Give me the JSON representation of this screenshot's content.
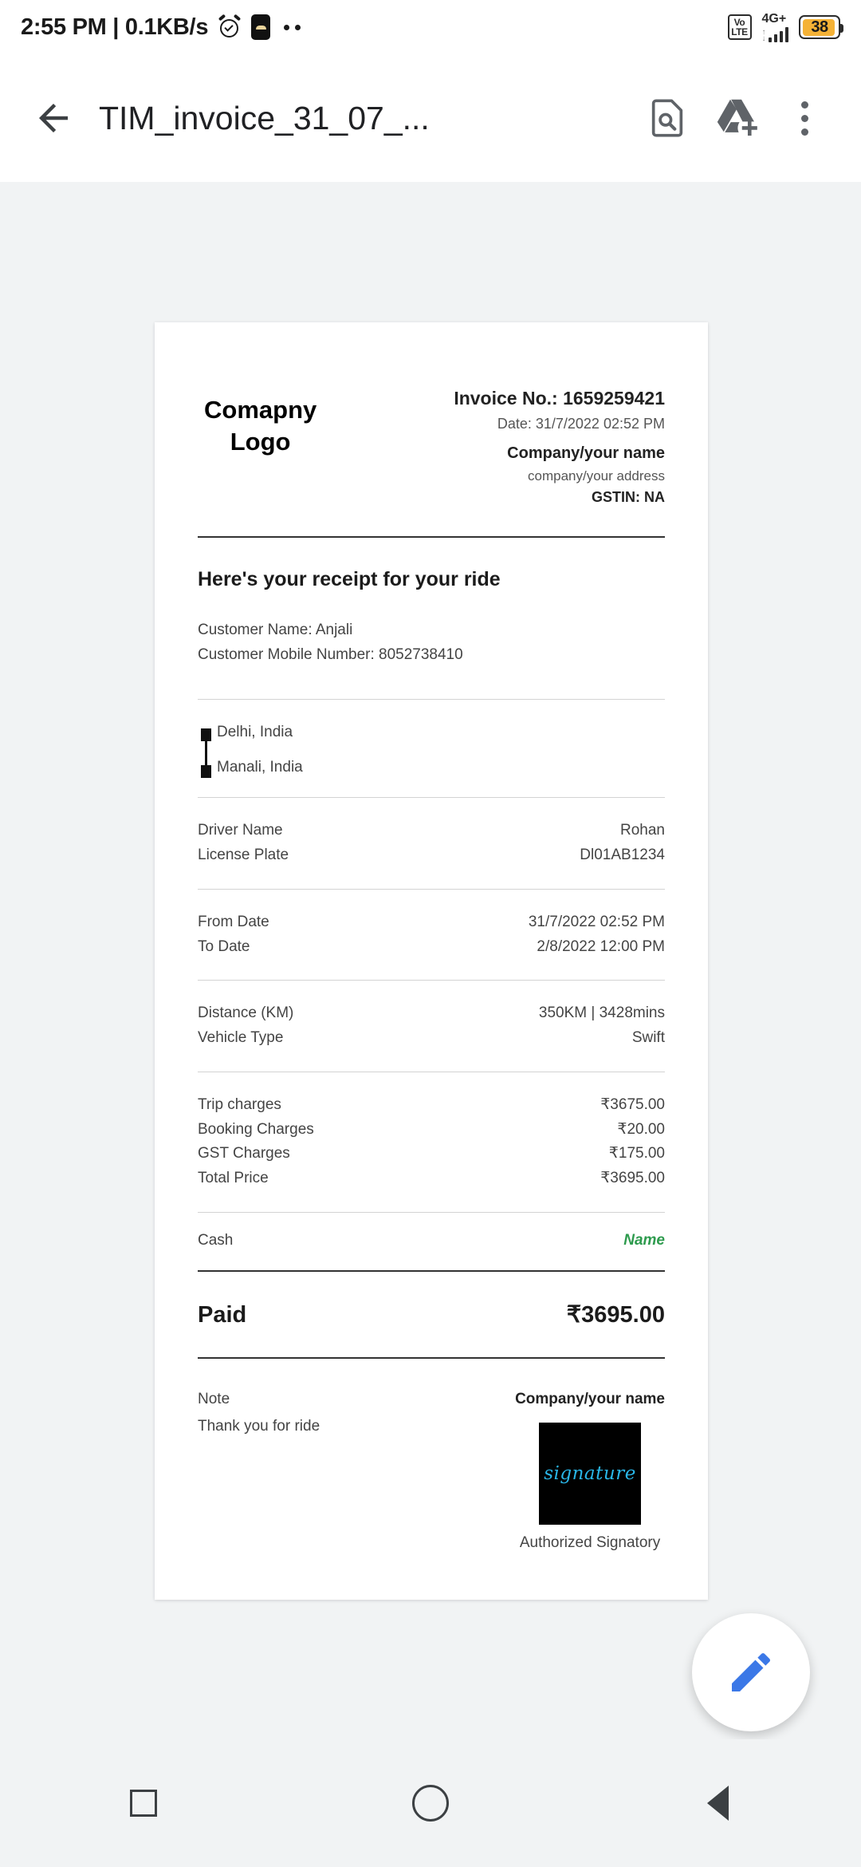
{
  "status_bar": {
    "time": "2:55 PM",
    "separator": "|",
    "network_speed": "0.1KB/s",
    "alarm_icon": "alarm-icon",
    "app_notification_icon": "app-badge-icon",
    "more_notifications_icon": "more-dots-icon",
    "volte_line1": "Vo",
    "volte_line2": "LTE",
    "network_type": "4G+",
    "signal_icon": "signal-bars-icon",
    "battery_percent": "38",
    "battery_color": "#f5b236"
  },
  "app_bar": {
    "back_icon": "back-arrow-icon",
    "title": "TIM_invoice_31_07_...",
    "find_icon": "document-search-icon",
    "drive_icon": "google-drive-add-icon",
    "overflow_icon": "overflow-menu-icon"
  },
  "invoice": {
    "logo_line1": "Comapny",
    "logo_line2": "Logo",
    "invoice_no": "Invoice No.: 1659259421",
    "date": "Date: 31/7/2022 02:52 PM",
    "company_name": "Company/your name",
    "company_address": "company/your address",
    "gstin": "GSTIN: NA",
    "receipt_heading": "Here's your receipt for your ride",
    "customer_name": "Customer Name: Anjali",
    "customer_mobile": "Customer Mobile Number: 8052738410",
    "route": {
      "origin": "Delhi, India",
      "destination": "Manali, India"
    },
    "detail_rows": [
      {
        "label": "Driver Name",
        "value": "Rohan"
      },
      {
        "label": "License Plate",
        "value": "Dl01AB1234"
      }
    ],
    "date_rows": [
      {
        "label": "From Date",
        "value": "31/7/2022 02:52 PM"
      },
      {
        "label": "To Date",
        "value": "2/8/2022 12:00 PM"
      }
    ],
    "trip_rows": [
      {
        "label": "Distance (KM)",
        "value": "350KM | 3428mins"
      },
      {
        "label": "Vehicle Type",
        "value": "Swift"
      }
    ],
    "charge_rows": [
      {
        "label": "Trip charges",
        "value": "₹3675.00"
      },
      {
        "label": "Booking Charges",
        "value": "₹20.00"
      },
      {
        "label": "GST Charges",
        "value": "₹175.00"
      },
      {
        "label": "Total Price",
        "value": "₹3695.00"
      }
    ],
    "payment_mode": "Cash",
    "payment_name": "Name",
    "payment_name_color": "#2e9b4e",
    "paid_label": "Paid",
    "paid_amount": "₹3695.00",
    "note_label": "Note",
    "note_text": "Thank you for ride",
    "signature_company": "Company/your name",
    "signature_word": "signature",
    "signature_caption": "Authorized Signatory"
  },
  "fab": {
    "icon": "edit-pencil-icon",
    "color": "#3b78e7"
  },
  "nav_bar": {
    "recents_icon": "recents-square-icon",
    "home_icon": "home-circle-icon",
    "back_icon": "back-triangle-icon"
  }
}
